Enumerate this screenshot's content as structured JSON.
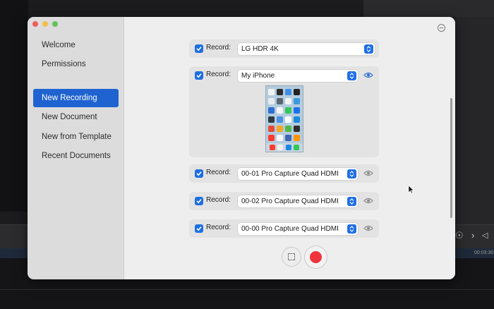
{
  "window": {
    "traffic_lights": [
      "#ee5f57",
      "#f4be4f",
      "#60c554"
    ],
    "menu_icon": "minus-circle-icon"
  },
  "sidebar": {
    "items": [
      {
        "label": "Welcome",
        "active": false
      },
      {
        "label": "Permissions",
        "active": false
      },
      {
        "label": "New Recording",
        "active": true
      },
      {
        "label": "New Document",
        "active": false
      },
      {
        "label": "New from Template",
        "active": false
      },
      {
        "label": "Recent Documents",
        "active": false
      }
    ],
    "active_color": "#1f63d0"
  },
  "sources": [
    {
      "record_label": "Record:",
      "checked": true,
      "device": "LG HDR 4K",
      "preview": false,
      "eye_active": false
    },
    {
      "record_label": "Record:",
      "checked": true,
      "device": "My iPhone",
      "preview": true,
      "eye_active": true
    },
    {
      "record_label": "Record:",
      "checked": true,
      "device": "00-01 Pro Capture Quad HDMI",
      "preview": false,
      "eye_active": false
    },
    {
      "record_label": "Record:",
      "checked": true,
      "device": "00-02 Pro Capture Quad HDMI",
      "preview": false,
      "eye_active": false
    },
    {
      "record_label": "Record:",
      "checked": true,
      "device": "00-00 Pro Capture Quad HDMI",
      "preview": false,
      "eye_active": false
    }
  ],
  "controls": {
    "screenshot_icon": "dashed-square-icon",
    "record_icon": "record-dot-icon",
    "record_color": "#f0343b"
  },
  "background_app": {
    "timecode": "00:03:30"
  },
  "colors": {
    "accent": "#1f6fe5",
    "eye_active": "#2a6fd6",
    "eye_inactive": "#8a8a8a"
  }
}
